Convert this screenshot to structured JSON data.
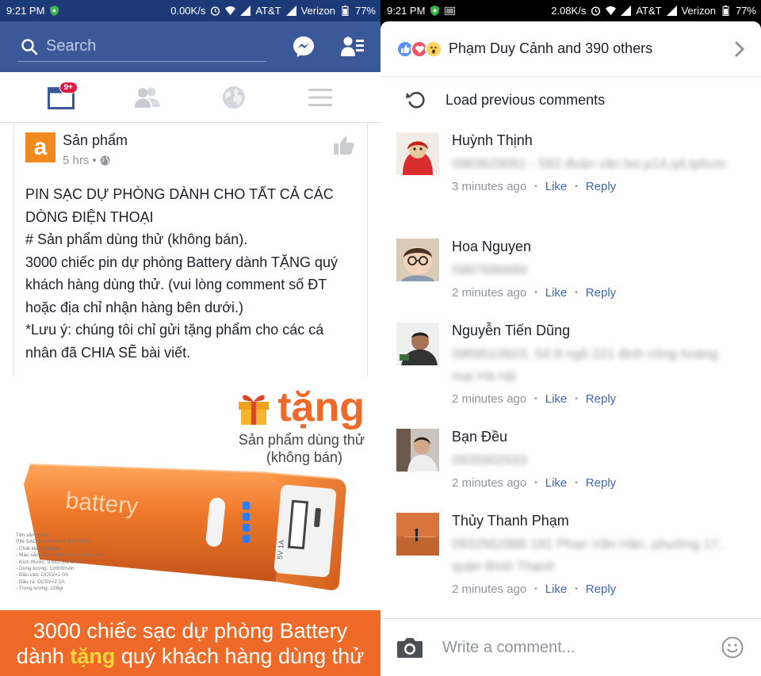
{
  "left_status": {
    "time": "9:21 PM",
    "speed": "0.00K/s",
    "carrier1": "AT&T",
    "carrier2": "Verizon",
    "battery": "77%"
  },
  "right_status": {
    "time": "9:21 PM",
    "speed": "2.08K/s",
    "carrier1": "AT&T",
    "carrier2": "Verizon",
    "battery": "77%"
  },
  "header": {
    "search_placeholder": "Search"
  },
  "tabs": {
    "news_badge": "9+"
  },
  "post": {
    "page_avatar_letter": "a",
    "page_name": "Sản phẩm",
    "time": "5 hrs",
    "lines": [
      "PIN SẠC DỰ PHÒNG DÀNH CHO TẤT CẢ CÁC",
      "DÒNG ĐIỆN THOẠI",
      "# Sản phẩm dùng thử (không bán).",
      "3000 chiếc pin dự phòng Battery dành TẶNG quý",
      "khách hàng dùng thử. (vui lòng comment số ĐT",
      "hoặc địa chỉ nhận hàng bên dưới.)",
      "*Lưu ý: chúng tôi chỉ gửi tặng phẩm cho các cá",
      "nhân đã CHIA SẼ bài viết."
    ]
  },
  "promo": {
    "tang": "tặng",
    "sub1": "Sản phẩm dùng thử",
    "sub2": "(không bán)",
    "battery_brand": "battery",
    "port_label": "5V 1A",
    "specs": [
      "Tên sản phẩm:",
      "PIN SẠC DỰ PHÒNG BATTERY",
      "- Chất liệu: Polymer",
      "- Màu sắc: xanh, hồng, vàng, bạc, cam",
      "- Kích thước: 9.6x2.3x2.3 mm",
      "- Dung lượng: 12000mAh",
      "- Đầu vào: DC5V=1.0A",
      "- Đầu ra: DC5V=2.1A",
      "- Trọng lượng: 226gr"
    ],
    "banner_line1": "3000 chiếc sạc dự phòng Battery",
    "banner_pre": "dành ",
    "banner_highlight": "tặng",
    "banner_post": " quý khách hàng dùng thử"
  },
  "reactions": {
    "text": "Phạm Duy Cảnh and 390 others"
  },
  "load_previous": "Load previous comments",
  "comment_actions": {
    "like": "Like",
    "reply": "Reply"
  },
  "comments": [
    {
      "name": "Huỳnh Thịnh",
      "text": "0963629061 - 582 đoàn văn bơ,p14,q4,tphcm",
      "time": "3 minutes ago"
    },
    {
      "name": "Hoa Nguyen",
      "text": "0987696689",
      "time": "2 minutes ago"
    },
    {
      "name": "Nguyễn Tiến Dũng",
      "text": "0969513923, Số 8 ngõ 221 định công hoàng mai Hà nội",
      "time": "2 minutes ago"
    },
    {
      "name": "Bạn Đều",
      "text": "0935902933",
      "time": "2 minutes ago"
    },
    {
      "name": "Thủy Thanh Phạm",
      "text": "0932562986 181 Phan Văn Hân, phường 17, quận Bình Thạnh",
      "time": "2 minutes ago"
    }
  ],
  "composer": {
    "placeholder": "Write a comment..."
  },
  "colors": {
    "facebook_blue": "#3b5998",
    "link_blue": "#4267b2",
    "promo_orange": "#ef6a28",
    "badge_red": "#e0183d"
  }
}
